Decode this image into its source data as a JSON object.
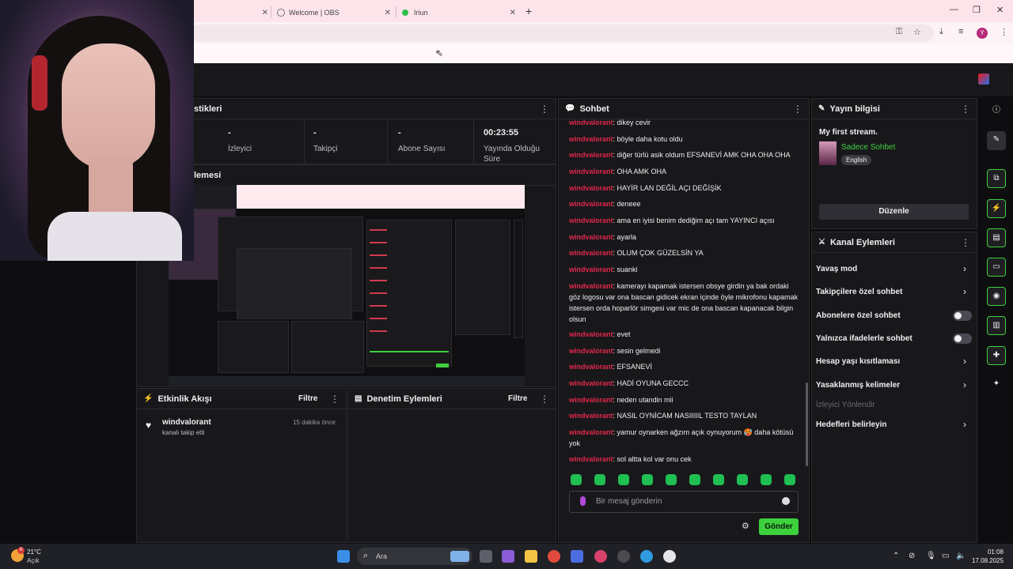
{
  "browser": {
    "tabs": [
      {
        "label": ""
      },
      {
        "label": "Welcome | OBS"
      },
      {
        "label": "Iriun"
      }
    ],
    "new_tab": "+",
    "win_min": "—",
    "win_max": "❐",
    "win_close": "✕",
    "profile_initial": "Y"
  },
  "panels": {
    "stats_title": "stikleri",
    "preview_title": "lemesi",
    "stats": [
      {
        "value": "-",
        "label": "İzleyici"
      },
      {
        "value": "-",
        "label": "Takipçi"
      },
      {
        "value": "-",
        "label": "Abone Sayısı"
      },
      {
        "value": "00:23:55",
        "label": "Yayında Olduğu Süre"
      }
    ],
    "activity": {
      "title": "Etkinlik Akışı",
      "filter": "Filtre",
      "item": {
        "user": "windvalorant",
        "text": "kanalı takip etti",
        "time": "15 dakika önce"
      }
    },
    "moderation": {
      "title": "Denetim Eylemleri",
      "filter": "Filtre"
    }
  },
  "chat": {
    "title": "Sohbet",
    "messages": [
      {
        "user": "windvalorant",
        "text": "dikey cevir"
      },
      {
        "user": "windvalorant",
        "text": "böyle daha kotu oldu"
      },
      {
        "user": "windvalorant",
        "text": "diğer türlü asik oldum EFSANEVİ AMK OHA OHA OHA"
      },
      {
        "user": "windvalorant",
        "text": "OHA AMK OHA"
      },
      {
        "user": "windvalorant",
        "text": "HAYİR LAN DEĞİL AÇI DEĞİŞİK"
      },
      {
        "user": "windvalorant",
        "text": "deneee"
      },
      {
        "user": "windvalorant",
        "text": "ama en iyisi benim dediğim açı tam YAYINCI açısı"
      },
      {
        "user": "windvalorant",
        "text": "ayarla"
      },
      {
        "user": "windvalorant",
        "text": "OLUM ÇOK GÜZELSİN YA"
      },
      {
        "user": "windvalorant",
        "text": "suanki"
      },
      {
        "user": "windvalorant",
        "text": "kamerayı kapamak istersen obsye girdin ya bak ordaki göz logosu var ona bascan gidicek ekran içinde öyle mikrofonu kapamak istersen orda hoparlör simgesi var mic de ona bascan kapanacak bilgin olsun"
      },
      {
        "user": "windvalorant",
        "text": "evet"
      },
      {
        "user": "windvalorant",
        "text": "sesin gelmedi"
      },
      {
        "user": "windvalorant",
        "text": "EFSANEVİ"
      },
      {
        "user": "windvalorant",
        "text": "HADİ OYUNA GECCC"
      },
      {
        "user": "windvalorant",
        "text": "neden utandin mii"
      },
      {
        "user": "windvalorant",
        "text": "NASIL OYNİCAM NASIIIIIL TESTO TAYLAN"
      },
      {
        "user": "windvalorant",
        "text": "yamur oynarken ağzım açık oynuyorum 🥵 daha kötüsü yok"
      },
      {
        "user": "windvalorant",
        "text": "sol altta kol var onu cek"
      }
    ],
    "placeholder": "Bir mesaj gönderin",
    "send": "Gönder"
  },
  "stream_info": {
    "title": "Yayın bilgisi",
    "stream_name": "My first stream.",
    "category": "Sadece Sohbet",
    "language": "English",
    "edit": "Düzenle"
  },
  "channel_actions": {
    "title": "Kanal Eylemleri",
    "items": [
      {
        "label": "Yavaş mod"
      },
      {
        "label": "Takipçilere özel sohbet"
      },
      {
        "label": "Abonelere özel sohbet"
      },
      {
        "label": "Yalnızca ifadelerle sohbet"
      },
      {
        "label": "Hesap yaşı kısıtlaması"
      },
      {
        "label": "Yasaklanmış kelimeler"
      },
      {
        "label": "İzleyici Yönlendir"
      },
      {
        "label": "Hedefleri belirleyin"
      }
    ]
  },
  "taskbar": {
    "weather_temp": "21°C",
    "weather_state": "Açık",
    "weather_badge": "6",
    "search": "Ara",
    "time": "01:08",
    "date": "17.08.2025"
  },
  "colors": {
    "accent": "#3ed13e",
    "username": "#e3274a",
    "panel": "#18181b"
  }
}
